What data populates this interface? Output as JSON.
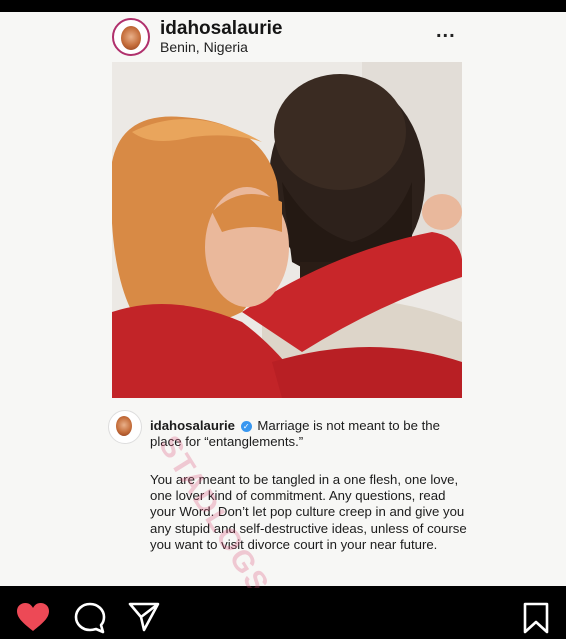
{
  "post": {
    "username": "idahosalaurie",
    "location": "Benin, Nigeria",
    "more_label": "...",
    "caption": {
      "username": "idahosalaurie",
      "verified_label": "✓",
      "headline": "Marriage is not meant to be the place for “entanglements.”",
      "body": "You are meant to be tangled in a one flesh, one love, one lover kind of commitment. Any questions, read your Word. Don’t let pop culture creep in and give you any stupid and self-destructive ideas, unless of course you want to visit divorce court in your near future."
    },
    "watermark": "STADLOGS"
  },
  "actions": {
    "like": "heart-icon",
    "comment": "comment-icon",
    "share": "paper-plane-icon",
    "save": "bookmark-icon",
    "like_color": "#ed4956"
  }
}
